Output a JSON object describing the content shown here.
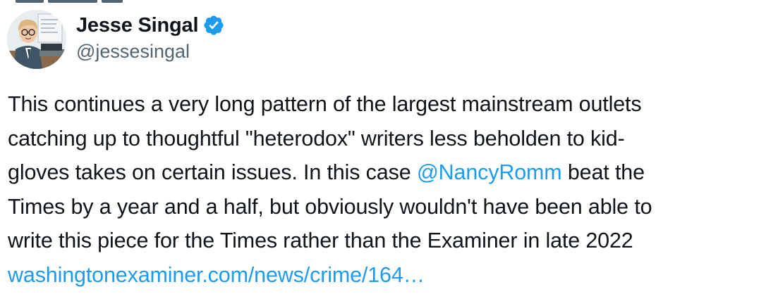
{
  "author": {
    "display_name": "Jesse Singal",
    "handle": "@jessesingal",
    "verified_color": "#1d9bf0",
    "avatar_icon": "cartoon-avatar"
  },
  "tweet": {
    "line1": "This continues a very long pattern of the largest mainstream outlets",
    "line2": "catching up to thoughtful \"heterodox\" writers less beholden to kid-",
    "line3_before": "gloves takes on certain issues. In this case ",
    "mention": "@NancyRomm",
    "line3_after": " beat the",
    "line4": "Times by a year and a half, but obviously wouldn't have been able to",
    "line5": "write this piece for the Times rather than the Examiner in late 2022",
    "link_text": "washingtonexaminer.com/news/crime/164…"
  },
  "colors": {
    "text": "#0f1419",
    "secondary": "#536471",
    "link": "#1d9bf0"
  }
}
